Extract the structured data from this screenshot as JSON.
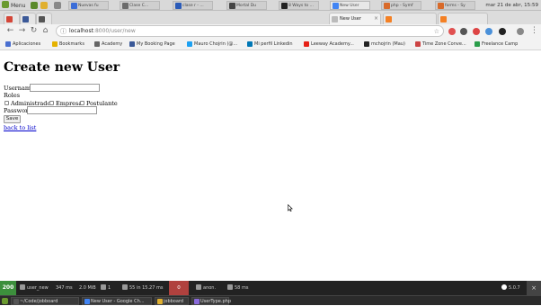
{
  "os_top": {
    "menu_label": "Menu",
    "windows": [
      "Nuevas fu",
      "Clase C...",
      "clase r - ...",
      "Mortal Du",
      "8 Ways to ...",
      "New User",
      "php - Symf",
      "forms - Sy"
    ],
    "clock": "mar 21 de abr, 15:59"
  },
  "browser": {
    "active_tab": "New User",
    "url_host": "localhost",
    "url_rest": ":8000/user/new",
    "bookmarks": [
      "Aplicaciones",
      "Bookmarks",
      "Academy",
      "My Booking Page",
      "Mauro Chojrin (@...",
      "Mi perfil Linkedin",
      "Leeway Academy...",
      "mchojrin (Mau)",
      "Time Zone Conve...",
      "Freelance Camp"
    ]
  },
  "page": {
    "title": "Create new User",
    "username_label": "Username",
    "roles_label": "Roles",
    "roles": [
      "Administrador",
      "Empresa",
      "Postulante"
    ],
    "password_label": "Password",
    "save_label": "Save",
    "back_link": "back to list"
  },
  "symfony_toolbar": {
    "status": "200",
    "route": "user_new",
    "time": "347 ms",
    "memory": "2.0 MiB",
    "forms": "1",
    "db": "55 in 15.27 ms",
    "errors": "0",
    "user": "anon.",
    "timing": "58 ms",
    "version": "5.0.7"
  },
  "taskbar": {
    "items": [
      "~/Code/jobboard",
      "New User - Google Ch...",
      "jobboard",
      "UserType.php"
    ]
  }
}
